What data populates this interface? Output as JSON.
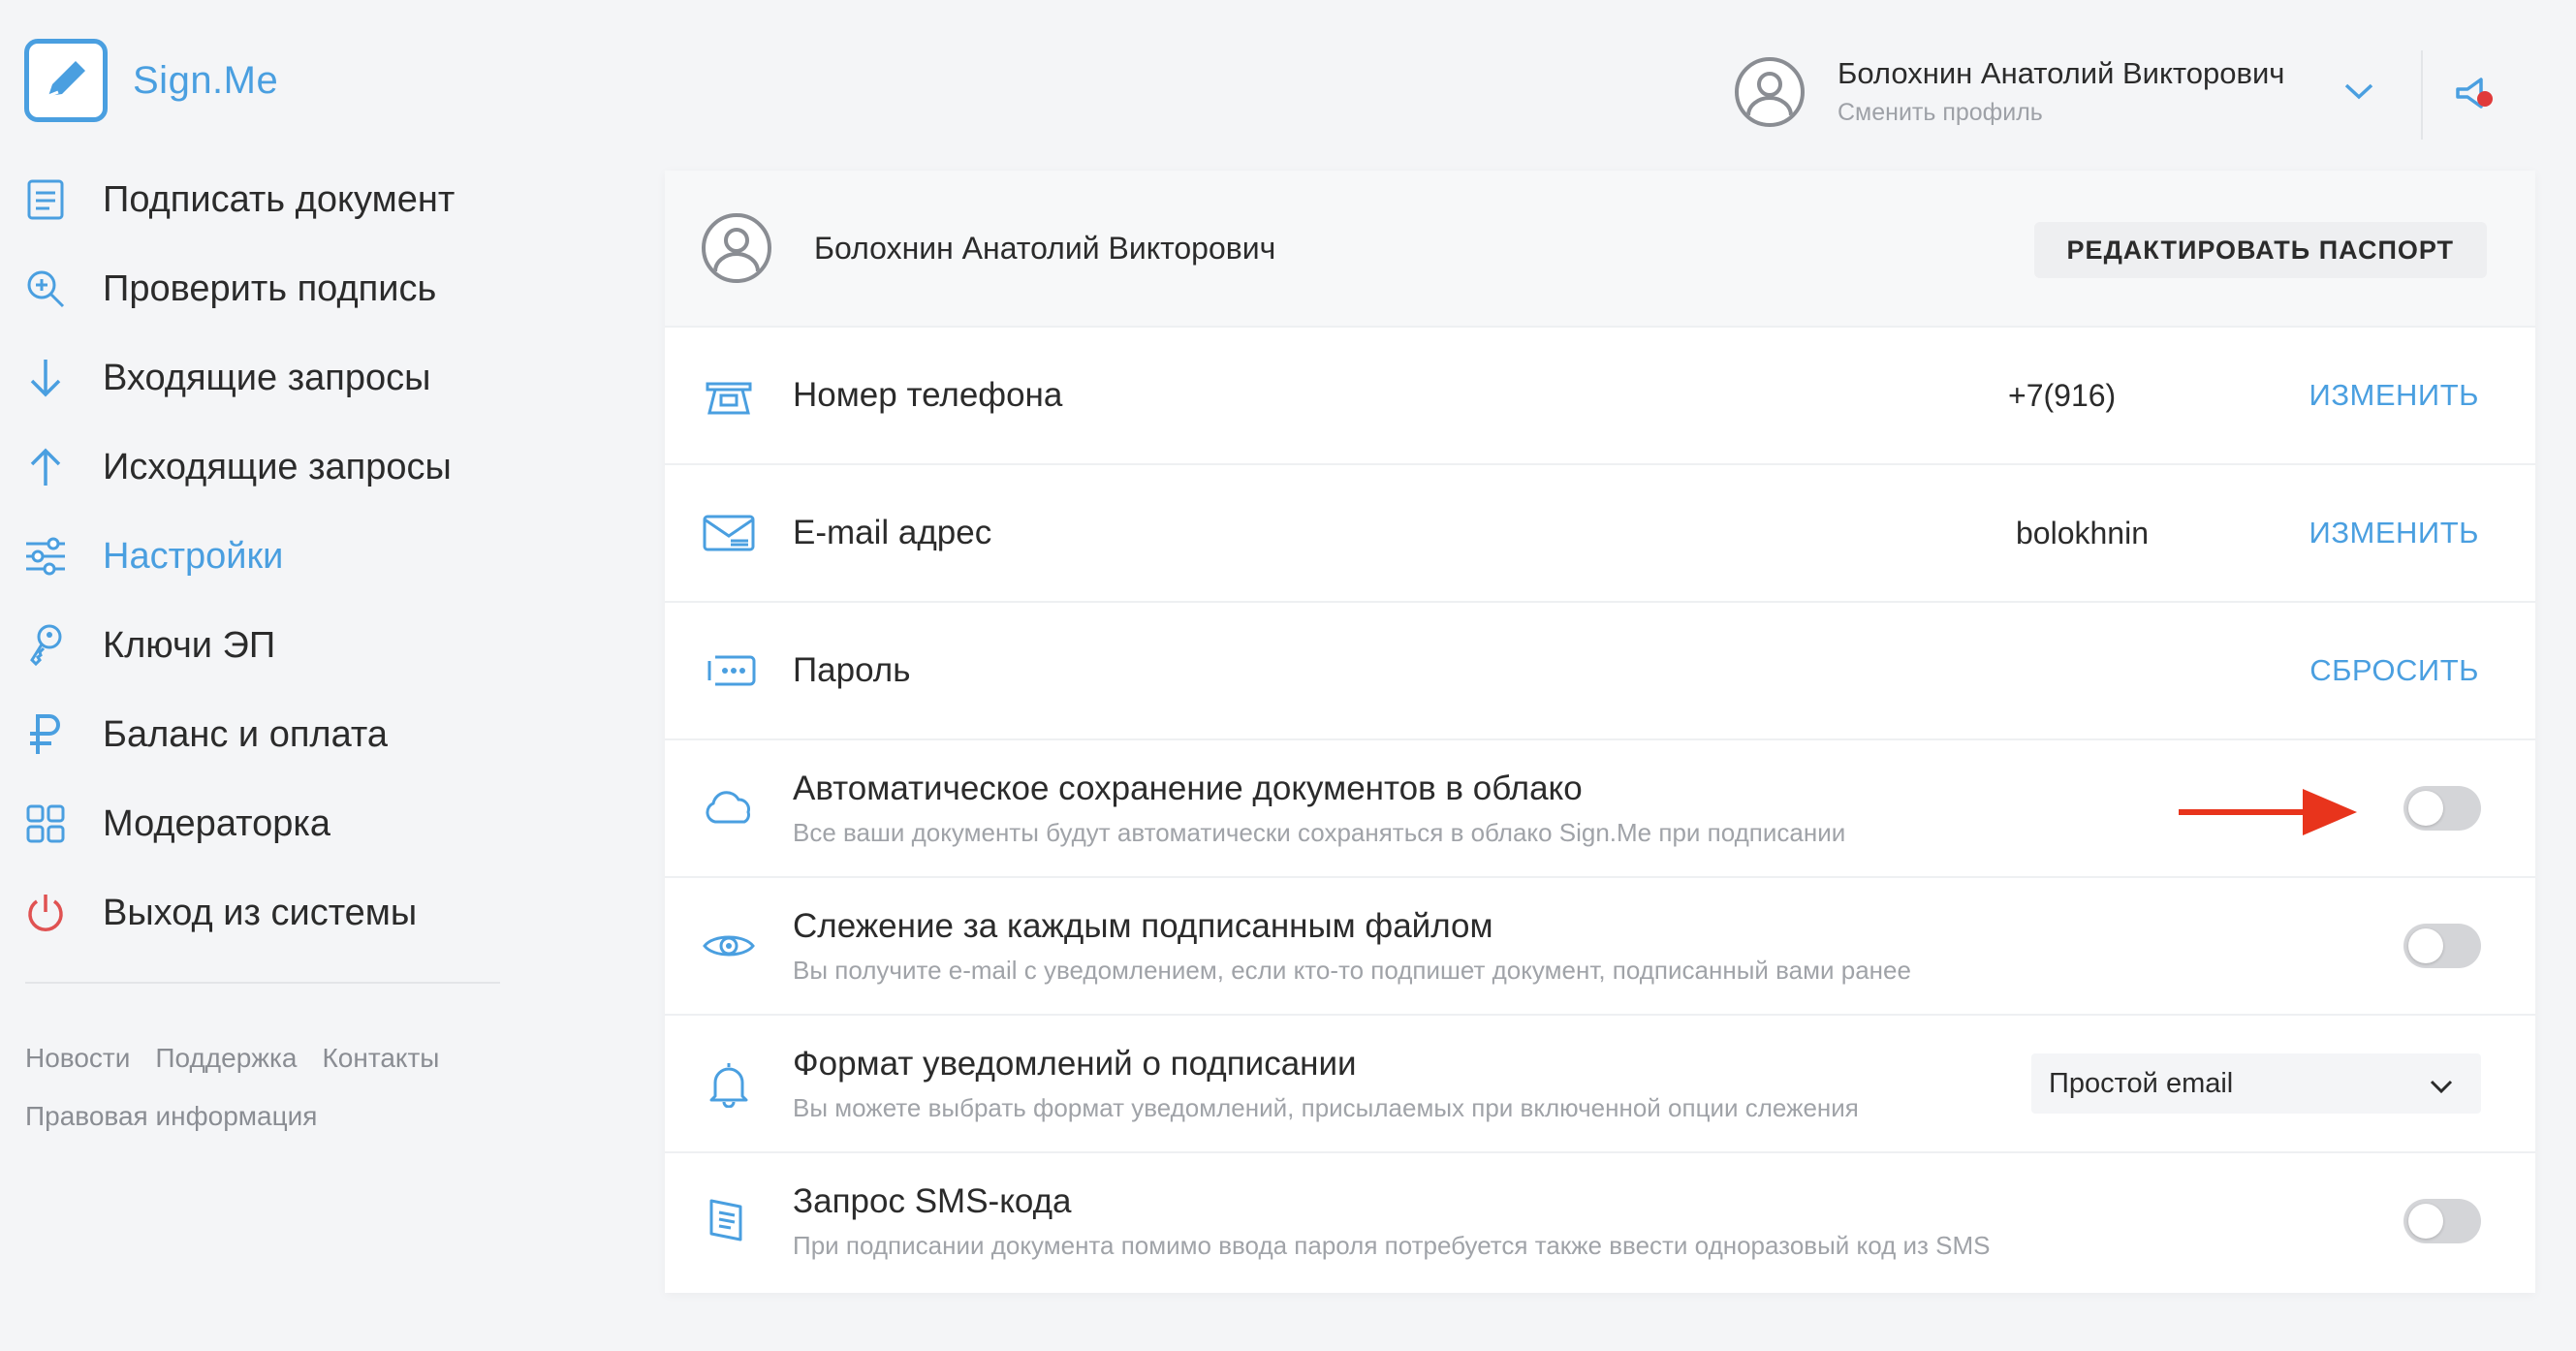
{
  "brand": {
    "name": "Sign.Me",
    "accent": "#4a9fe0",
    "danger": "#e05252"
  },
  "sidebar": {
    "items": [
      {
        "label": "Подписать документ",
        "icon": "document-icon",
        "active": false
      },
      {
        "label": "Проверить подпись",
        "icon": "search-plus-icon",
        "active": false
      },
      {
        "label": "Входящие запросы",
        "icon": "arrow-down-icon",
        "active": false
      },
      {
        "label": "Исходящие запросы",
        "icon": "arrow-up-icon",
        "active": false
      },
      {
        "label": "Настройки",
        "icon": "sliders-icon",
        "active": true
      },
      {
        "label": "Ключи ЭП",
        "icon": "key-icon",
        "active": false
      },
      {
        "label": "Баланс и оплата",
        "icon": "ruble-icon",
        "active": false
      },
      {
        "label": "Модераторка",
        "icon": "grid-icon",
        "active": false
      },
      {
        "label": "Выход из системы",
        "icon": "power-icon",
        "active": false
      }
    ],
    "footer": {
      "news": "Новости",
      "support": "Поддержка",
      "contacts": "Контакты",
      "legal": "Правовая информация"
    }
  },
  "header": {
    "user_name": "Болохнин Анатолий Викторович",
    "switch_profile": "Сменить профиль"
  },
  "panel": {
    "user_name": "Болохнин Анатолий Викторович",
    "edit_passport": "РЕДАКТИРОВАТЬ ПАСПОРТ",
    "phone": {
      "title": "Номер телефона",
      "value": "+7(916)",
      "action": "ИЗМЕНИТЬ"
    },
    "email": {
      "title": "E-mail адрес",
      "value": "bolokhnin",
      "action": "ИЗМЕНИТЬ"
    },
    "password": {
      "title": "Пароль",
      "action": "СБРОСИТЬ"
    },
    "cloud": {
      "title": "Автоматическое сохранение документов в облако",
      "desc": "Все ваши документы будут автоматически сохраняться в облако Sign.Me при подписании",
      "enabled": false
    },
    "tracking": {
      "title": "Слежение за каждым подписанным файлом",
      "desc": "Вы получите e-mail с уведомлением, если кто-то подпишет документ, подписанный вами ранее",
      "enabled": false
    },
    "notify_format": {
      "title": "Формат уведомлений о подписании",
      "desc": "Вы можете выбрать формат уведомлений, присылаемых при включенной опции слежения",
      "selected": "Простой email"
    },
    "sms": {
      "title": "Запрос SMS-кода",
      "desc": "При подписании документа помимо ввода пароля потребуется также ввести одноразовый код из SMS",
      "enabled": false
    }
  }
}
